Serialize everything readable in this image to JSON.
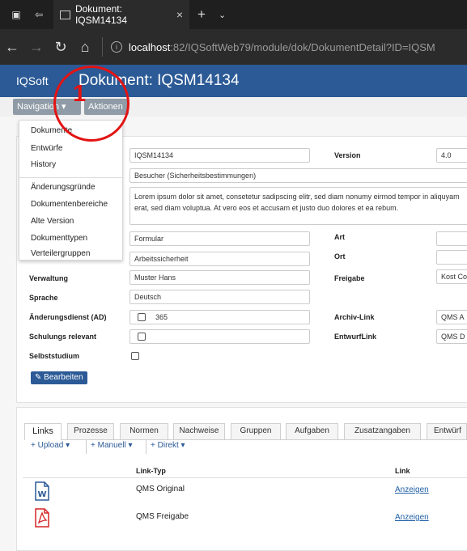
{
  "browser": {
    "tab_title": "Dokument: IQSM14134",
    "url_host": "localhost",
    "url_path": ":82/IQSoftWeb79/module/dok/DokumentDetail?ID=IQSM"
  },
  "app": {
    "brand": "IQSoft",
    "title": "Dokument: IQSM14134",
    "nav_label": "Navigation",
    "actions_label": "Aktionen",
    "annotation_number": "1"
  },
  "navigation_menu": {
    "items": [
      "Dokumente",
      "Entwürfe",
      "History",
      "Änderungsgründe",
      "Dokumentenbereiche",
      "Alte Version",
      "Dokumenttypen",
      "Verteilergruppen"
    ]
  },
  "document": {
    "id": "IQSM14134",
    "category": "Besucher (Sicherheitsbestimmungen)",
    "description": "Lorem ipsum dolor sit amet, consetetur sadipscing elitr, sed diam nonumy eirmod tempor in aliquyam erat, sed diam voluptua. At vero eos et accusam et justo duo dolores et ea rebum.",
    "form": "Formular",
    "area": "Arbeitssicherheit",
    "administration": "Muster Hans",
    "language": "Deutsch",
    "change_service_value": "365",
    "labels": {
      "version": "Version",
      "art": "Art",
      "ort": "Ort",
      "verwaltung": "Verwaltung",
      "sprache": "Sprache",
      "aenderungsdienst": "Änderungsdienst (AD)",
      "schulung": "Schulungs relevant",
      "selbststudium": "Selbststudium",
      "freigabe": "Freigabe",
      "archiv": "Archiv-Link",
      "entwurf": "EntwurfLink"
    },
    "version_value": "4.0",
    "freigabe_value": "Kost Co",
    "archiv_value": "QMS A",
    "entwurf_value": "QMS D",
    "edit_button": "Bearbeiten"
  },
  "links_panel": {
    "tabs": [
      "Links",
      "Prozesse",
      "Normen",
      "Nachweise",
      "Gruppen",
      "Aufgaben",
      "Zusatzangaben",
      "Entwürf"
    ],
    "toolbar": {
      "upload": "Upload",
      "manuell": "Manuell",
      "direkt": "Direkt"
    },
    "headers": {
      "link_type": "Link-Typ",
      "link": "Link"
    },
    "rows": [
      {
        "type": "QMS Original",
        "action": "Anzeigen"
      },
      {
        "type": "QMS Freigabe",
        "action": "Anzeigen"
      }
    ]
  },
  "colors": {
    "app_header": "#2b5a96",
    "annotation": "#e31313"
  }
}
